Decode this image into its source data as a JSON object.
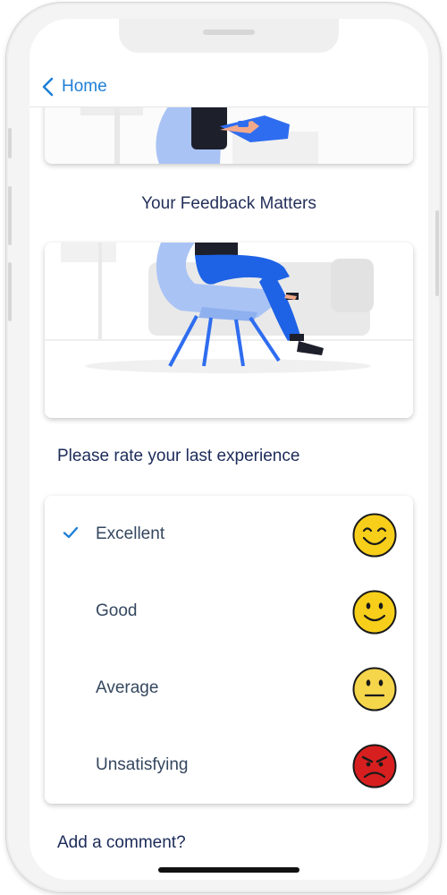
{
  "nav": {
    "back_label": "Home"
  },
  "feedback": {
    "title": "Your Feedback Matters"
  },
  "rating": {
    "prompt": "Please rate your last experience",
    "selected_index": 0,
    "options": [
      {
        "label": "Excellent",
        "icon": "grinning-face-icon",
        "color": "#f7cf1a"
      },
      {
        "label": "Good",
        "icon": "smiling-face-icon",
        "color": "#f7cf1a"
      },
      {
        "label": "Average",
        "icon": "neutral-face-icon",
        "color": "#f5d54a"
      },
      {
        "label": "Unsatisfying",
        "icon": "angry-face-icon",
        "color": "#d81f1f"
      }
    ]
  },
  "comment": {
    "title": "Add a comment?"
  },
  "colors": {
    "accent": "#1e7fd6",
    "title_text": "#1c2b59",
    "label_text": "#34475f",
    "chair": "#2f6df0",
    "pants": "#1e62e6"
  }
}
